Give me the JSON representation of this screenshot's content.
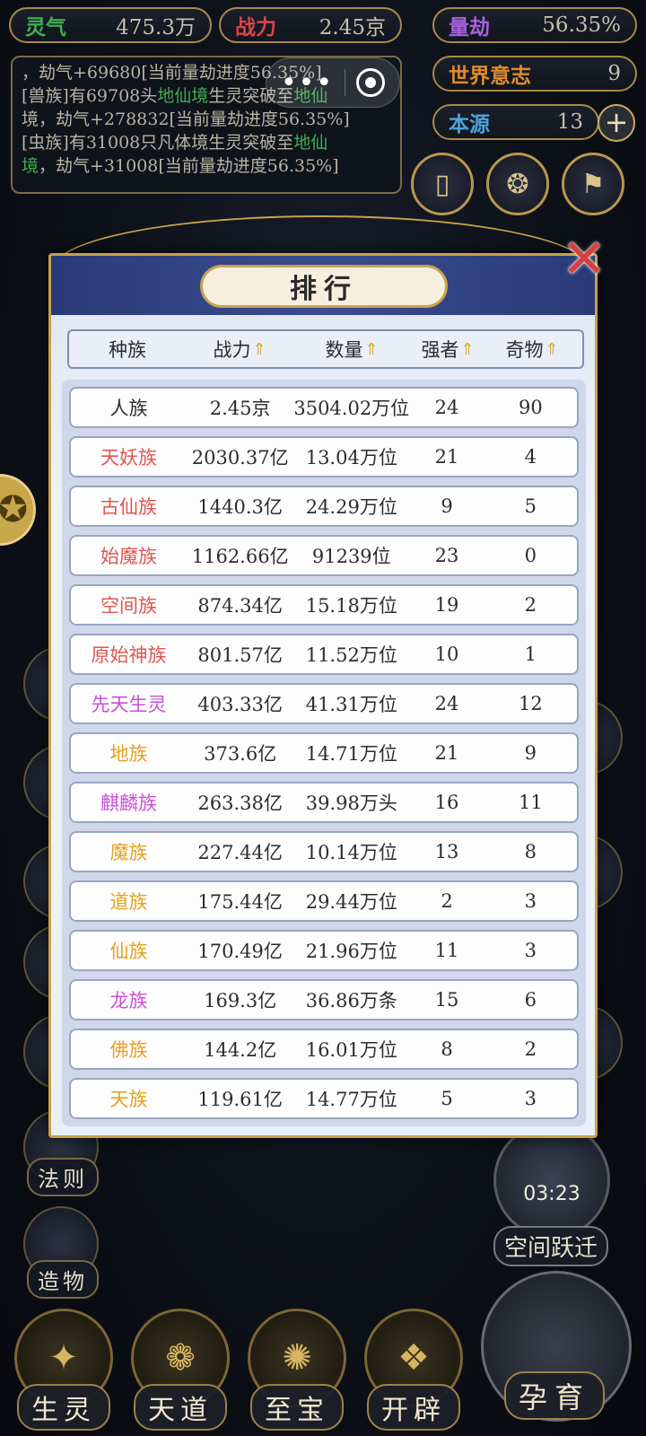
{
  "stats": [
    {
      "label": "灵气",
      "value": "475.3万",
      "color": "#3fae4f"
    },
    {
      "label": "战力",
      "value": "2.45京",
      "color": "#d8454a"
    },
    {
      "label": "量劫",
      "value": "56.35%",
      "color": "#a463d8"
    },
    {
      "label": "世界意志",
      "value": "9",
      "color": "#e08a2a"
    },
    {
      "label": "本源",
      "value": "13",
      "color": "#4ba3d8"
    }
  ],
  "log": {
    "line1": "，劫气+69680[当前量劫进度56.35%]",
    "line2_pre": "[兽族]有69708头",
    "line2_hl": "地仙境",
    "line2_post": "生灵突破至",
    "line2_hl2": "地仙",
    "line3": "境，劫气+278832[当前量劫进度56.35%]",
    "line4_pre": "[虫族]有31008只凡体境生灵突破至",
    "line4_hl": "地仙",
    "line5_hl": "境",
    "line5_post": "，劫气+31008[当前量劫进度56.35%]"
  },
  "capsule": {
    "more": "•••"
  },
  "plus_label": "+",
  "modal": {
    "title": "排行",
    "close": "✕",
    "headers": {
      "race": "种族",
      "power": "战力",
      "count": "数量",
      "strong": "强者",
      "treasure": "奇物"
    },
    "sort_icon": "⇑",
    "rows": [
      {
        "race": "人族",
        "power": "2.45京",
        "count": "3504.02万位",
        "strong": "24",
        "treasure": "90",
        "color": "#2c2c2c"
      },
      {
        "race": "天妖族",
        "power": "2030.37亿",
        "count": "13.04万位",
        "strong": "21",
        "treasure": "4",
        "color": "#e0554f"
      },
      {
        "race": "古仙族",
        "power": "1440.3亿",
        "count": "24.29万位",
        "strong": "9",
        "treasure": "5",
        "color": "#e0554f"
      },
      {
        "race": "始魔族",
        "power": "1162.66亿",
        "count": "91239位",
        "strong": "23",
        "treasure": "0",
        "color": "#e0554f"
      },
      {
        "race": "空间族",
        "power": "874.34亿",
        "count": "15.18万位",
        "strong": "19",
        "treasure": "2",
        "color": "#e0554f"
      },
      {
        "race": "原始神族",
        "power": "801.57亿",
        "count": "11.52万位",
        "strong": "10",
        "treasure": "1",
        "color": "#e0554f"
      },
      {
        "race": "先天生灵",
        "power": "403.33亿",
        "count": "41.31万位",
        "strong": "24",
        "treasure": "12",
        "color": "#c94fd6"
      },
      {
        "race": "地族",
        "power": "373.6亿",
        "count": "14.71万位",
        "strong": "21",
        "treasure": "9",
        "color": "#e5a11e"
      },
      {
        "race": "麒麟族",
        "power": "263.38亿",
        "count": "39.98万头",
        "strong": "16",
        "treasure": "11",
        "color": "#c94fd6"
      },
      {
        "race": "魔族",
        "power": "227.44亿",
        "count": "10.14万位",
        "strong": "13",
        "treasure": "8",
        "color": "#e5a11e"
      },
      {
        "race": "道族",
        "power": "175.44亿",
        "count": "29.44万位",
        "strong": "2",
        "treasure": "3",
        "color": "#e5a11e"
      },
      {
        "race": "仙族",
        "power": "170.49亿",
        "count": "21.96万位",
        "strong": "11",
        "treasure": "3",
        "color": "#e5a11e"
      },
      {
        "race": "龙族",
        "power": "169.3亿",
        "count": "36.86万条",
        "strong": "15",
        "treasure": "6",
        "color": "#c94fd6"
      },
      {
        "race": "佛族",
        "power": "144.2亿",
        "count": "16.01万位",
        "strong": "8",
        "treasure": "2",
        "color": "#e5a11e"
      },
      {
        "race": "天族",
        "power": "119.61亿",
        "count": "14.77万位",
        "strong": "5",
        "treasure": "3",
        "color": "#e5a11e"
      }
    ]
  },
  "side": {
    "law": "法则",
    "create": "造物"
  },
  "timer": {
    "time": "03:23",
    "label": "空间跃迁"
  },
  "nav": [
    {
      "label": "生灵"
    },
    {
      "label": "天道"
    },
    {
      "label": "至宝"
    },
    {
      "label": "开辟"
    }
  ],
  "yunyu": "孕育"
}
